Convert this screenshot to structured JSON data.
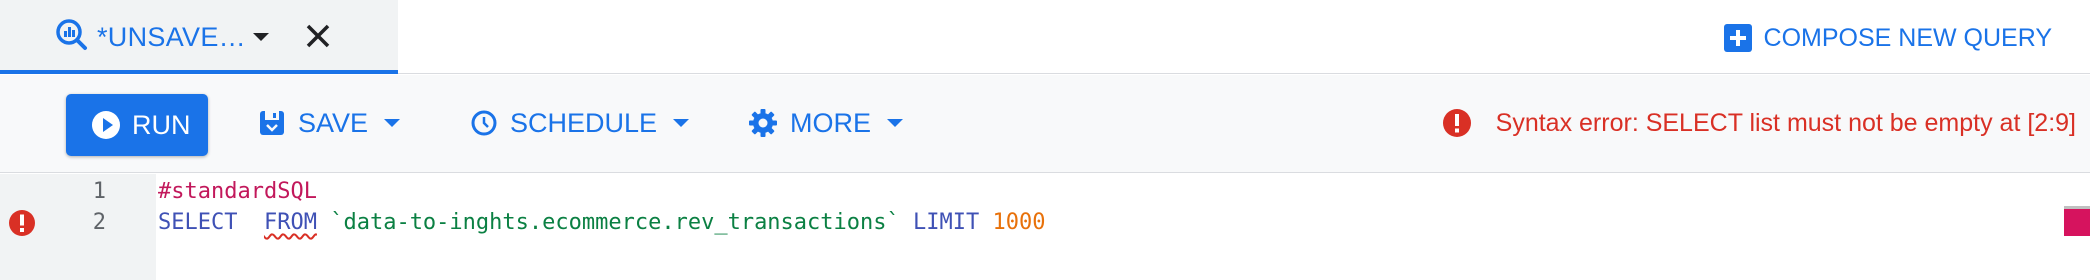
{
  "tab": {
    "label": "*UNSAVE…",
    "icon": "query-icon",
    "dropdown_icon": "caret-down-icon",
    "close_icon": "close-icon"
  },
  "header": {
    "compose_label": "COMPOSE NEW QUERY",
    "compose_icon": "add-box-icon"
  },
  "toolbar": {
    "run_label": "RUN",
    "run_icon": "play-circle-icon",
    "save_label": "SAVE",
    "save_icon": "save-icon",
    "schedule_label": "SCHEDULE",
    "schedule_icon": "clock-icon",
    "more_label": "MORE",
    "more_icon": "gear-icon"
  },
  "status": {
    "error_text": "Syntax error: SELECT list must not be empty at [2:9]",
    "error_icon": "error-icon"
  },
  "editor": {
    "lines": [
      {
        "number": "1",
        "comment": "#standardSQL"
      },
      {
        "number": "2",
        "kw_select": "SELECT",
        "kw_from": "FROM",
        "table": "`data-to-inghts.ecommerce.rev_transactions`",
        "kw_limit": "LIMIT",
        "limit_value": "1000"
      }
    ]
  },
  "colors": {
    "accent": "#1a73e8",
    "error": "#d93025",
    "keyword": "#3f51b5",
    "comment": "#c2185b",
    "string": "#0b8043",
    "number": "#e8710a"
  }
}
